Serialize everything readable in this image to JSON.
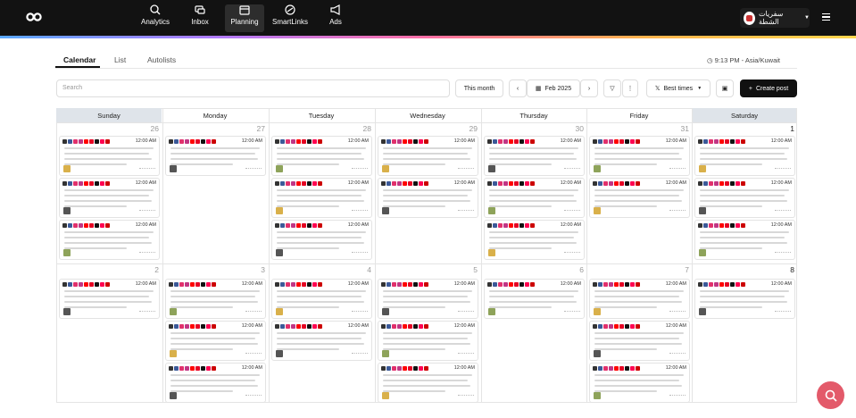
{
  "nav": {
    "items": [
      {
        "label": "Analytics"
      },
      {
        "label": "Inbox"
      },
      {
        "label": "Planning"
      },
      {
        "label": "SmartLinks"
      },
      {
        "label": "Ads"
      }
    ]
  },
  "brand": {
    "name": "سفريات الشطة"
  },
  "tabs": [
    {
      "label": "Calendar"
    },
    {
      "label": "List"
    },
    {
      "label": "Autolists"
    }
  ],
  "timezone": "9:13 PM - Asia/Kuwait",
  "toolbar": {
    "search_placeholder": "Search",
    "this_month": "This month",
    "month": "Feb 2025",
    "best_times": "Best times",
    "create_post": "Create post"
  },
  "days": [
    "Sunday",
    "Monday",
    "Tuesday",
    "Wednesday",
    "Thursday",
    "Friday",
    "Saturday"
  ],
  "week1": [
    "26",
    "27",
    "28",
    "29",
    "30",
    "31",
    "1"
  ],
  "week2": [
    "2",
    "3",
    "4",
    "5",
    "6",
    "7",
    "8"
  ],
  "post_time": "12:00 AM",
  "colors": {
    "accent": "#e35a6a",
    "thumb_green": "#8ea35a",
    "thumb_yellow": "#d9b04a"
  }
}
